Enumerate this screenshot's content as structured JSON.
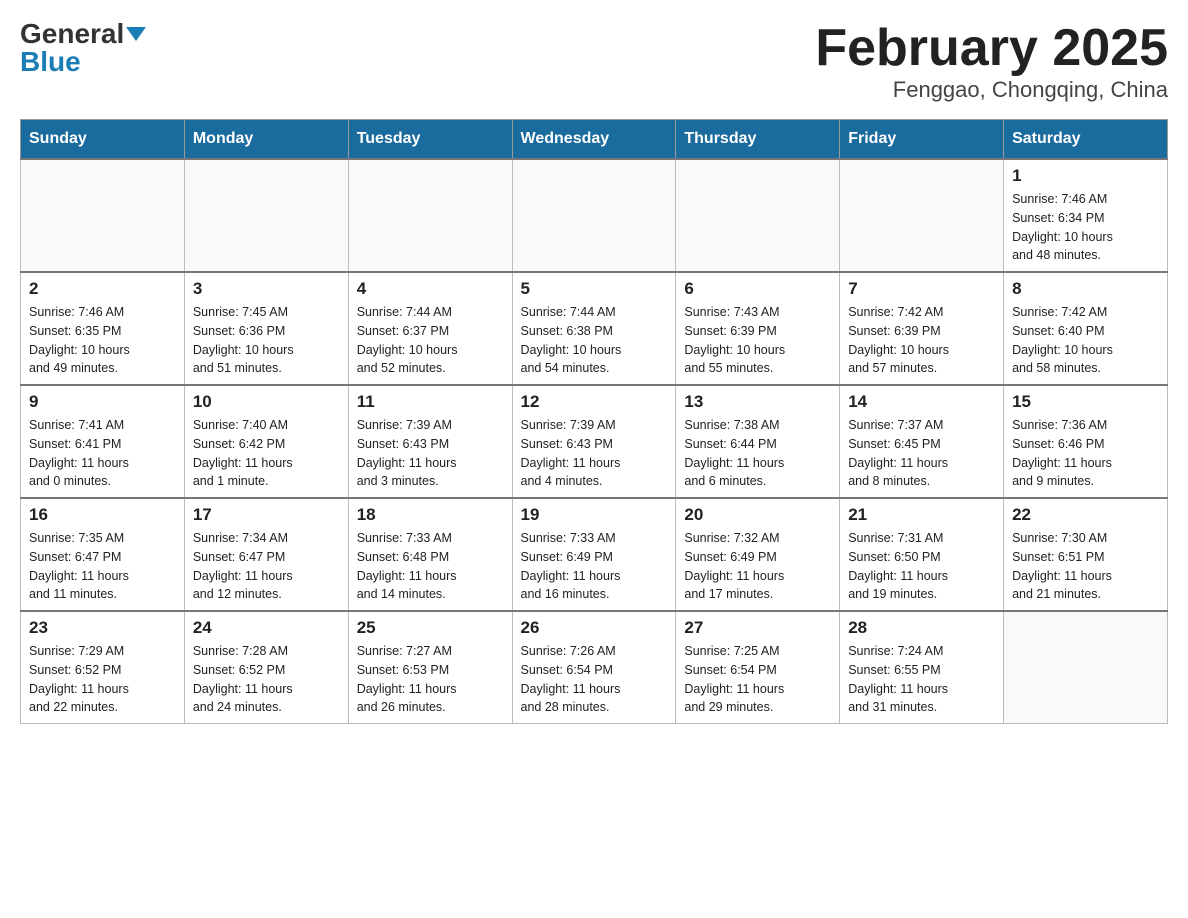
{
  "header": {
    "logo_general": "General",
    "logo_blue": "Blue",
    "title": "February 2025",
    "subtitle": "Fenggao, Chongqing, China"
  },
  "days_of_week": [
    "Sunday",
    "Monday",
    "Tuesday",
    "Wednesday",
    "Thursday",
    "Friday",
    "Saturday"
  ],
  "weeks": [
    [
      {
        "day": "",
        "info": ""
      },
      {
        "day": "",
        "info": ""
      },
      {
        "day": "",
        "info": ""
      },
      {
        "day": "",
        "info": ""
      },
      {
        "day": "",
        "info": ""
      },
      {
        "day": "",
        "info": ""
      },
      {
        "day": "1",
        "info": "Sunrise: 7:46 AM\nSunset: 6:34 PM\nDaylight: 10 hours\nand 48 minutes."
      }
    ],
    [
      {
        "day": "2",
        "info": "Sunrise: 7:46 AM\nSunset: 6:35 PM\nDaylight: 10 hours\nand 49 minutes."
      },
      {
        "day": "3",
        "info": "Sunrise: 7:45 AM\nSunset: 6:36 PM\nDaylight: 10 hours\nand 51 minutes."
      },
      {
        "day": "4",
        "info": "Sunrise: 7:44 AM\nSunset: 6:37 PM\nDaylight: 10 hours\nand 52 minutes."
      },
      {
        "day": "5",
        "info": "Sunrise: 7:44 AM\nSunset: 6:38 PM\nDaylight: 10 hours\nand 54 minutes."
      },
      {
        "day": "6",
        "info": "Sunrise: 7:43 AM\nSunset: 6:39 PM\nDaylight: 10 hours\nand 55 minutes."
      },
      {
        "day": "7",
        "info": "Sunrise: 7:42 AM\nSunset: 6:39 PM\nDaylight: 10 hours\nand 57 minutes."
      },
      {
        "day": "8",
        "info": "Sunrise: 7:42 AM\nSunset: 6:40 PM\nDaylight: 10 hours\nand 58 minutes."
      }
    ],
    [
      {
        "day": "9",
        "info": "Sunrise: 7:41 AM\nSunset: 6:41 PM\nDaylight: 11 hours\nand 0 minutes."
      },
      {
        "day": "10",
        "info": "Sunrise: 7:40 AM\nSunset: 6:42 PM\nDaylight: 11 hours\nand 1 minute."
      },
      {
        "day": "11",
        "info": "Sunrise: 7:39 AM\nSunset: 6:43 PM\nDaylight: 11 hours\nand 3 minutes."
      },
      {
        "day": "12",
        "info": "Sunrise: 7:39 AM\nSunset: 6:43 PM\nDaylight: 11 hours\nand 4 minutes."
      },
      {
        "day": "13",
        "info": "Sunrise: 7:38 AM\nSunset: 6:44 PM\nDaylight: 11 hours\nand 6 minutes."
      },
      {
        "day": "14",
        "info": "Sunrise: 7:37 AM\nSunset: 6:45 PM\nDaylight: 11 hours\nand 8 minutes."
      },
      {
        "day": "15",
        "info": "Sunrise: 7:36 AM\nSunset: 6:46 PM\nDaylight: 11 hours\nand 9 minutes."
      }
    ],
    [
      {
        "day": "16",
        "info": "Sunrise: 7:35 AM\nSunset: 6:47 PM\nDaylight: 11 hours\nand 11 minutes."
      },
      {
        "day": "17",
        "info": "Sunrise: 7:34 AM\nSunset: 6:47 PM\nDaylight: 11 hours\nand 12 minutes."
      },
      {
        "day": "18",
        "info": "Sunrise: 7:33 AM\nSunset: 6:48 PM\nDaylight: 11 hours\nand 14 minutes."
      },
      {
        "day": "19",
        "info": "Sunrise: 7:33 AM\nSunset: 6:49 PM\nDaylight: 11 hours\nand 16 minutes."
      },
      {
        "day": "20",
        "info": "Sunrise: 7:32 AM\nSunset: 6:49 PM\nDaylight: 11 hours\nand 17 minutes."
      },
      {
        "day": "21",
        "info": "Sunrise: 7:31 AM\nSunset: 6:50 PM\nDaylight: 11 hours\nand 19 minutes."
      },
      {
        "day": "22",
        "info": "Sunrise: 7:30 AM\nSunset: 6:51 PM\nDaylight: 11 hours\nand 21 minutes."
      }
    ],
    [
      {
        "day": "23",
        "info": "Sunrise: 7:29 AM\nSunset: 6:52 PM\nDaylight: 11 hours\nand 22 minutes."
      },
      {
        "day": "24",
        "info": "Sunrise: 7:28 AM\nSunset: 6:52 PM\nDaylight: 11 hours\nand 24 minutes."
      },
      {
        "day": "25",
        "info": "Sunrise: 7:27 AM\nSunset: 6:53 PM\nDaylight: 11 hours\nand 26 minutes."
      },
      {
        "day": "26",
        "info": "Sunrise: 7:26 AM\nSunset: 6:54 PM\nDaylight: 11 hours\nand 28 minutes."
      },
      {
        "day": "27",
        "info": "Sunrise: 7:25 AM\nSunset: 6:54 PM\nDaylight: 11 hours\nand 29 minutes."
      },
      {
        "day": "28",
        "info": "Sunrise: 7:24 AM\nSunset: 6:55 PM\nDaylight: 11 hours\nand 31 minutes."
      },
      {
        "day": "",
        "info": ""
      }
    ]
  ]
}
